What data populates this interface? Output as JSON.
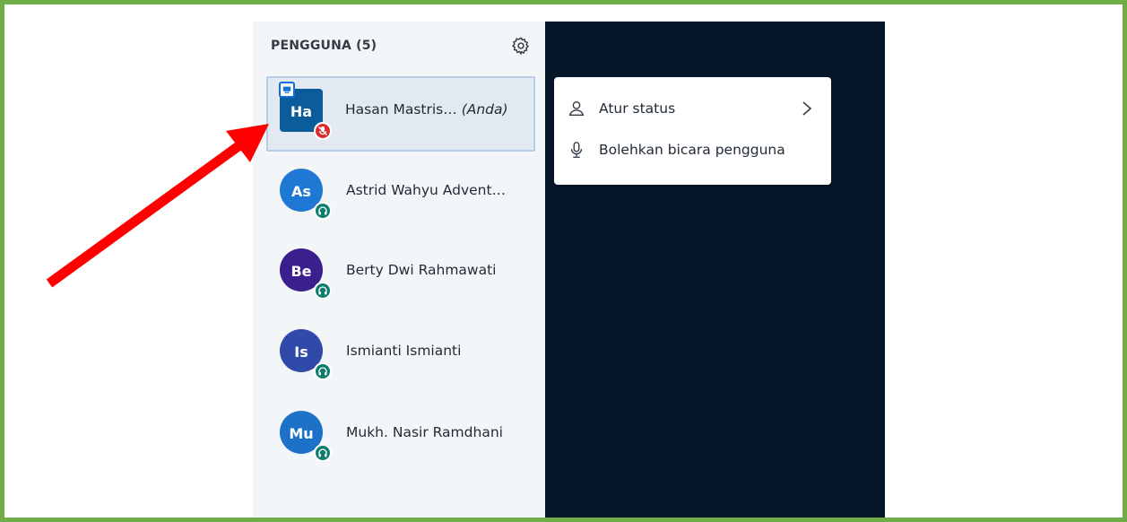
{
  "panel": {
    "header": "PENGGUNA (5)",
    "settings_icon": "gear-icon"
  },
  "users": [
    {
      "initials": "Ha",
      "name": "Hasan Mastris…",
      "suffix": "(Anda)",
      "color": "#0b5c9a",
      "status": "muted",
      "presenter": true,
      "selected": true
    },
    {
      "initials": "As",
      "name": "Astrid Wahyu Advent…",
      "color": "#1e78d4",
      "status": "listen-only"
    },
    {
      "initials": "Be",
      "name": "Berty Dwi Rahmawati",
      "color": "#3b1f8e",
      "status": "listen-only"
    },
    {
      "initials": "Is",
      "name": "Ismianti Ismianti",
      "color": "#2f4aa8",
      "status": "listen-only"
    },
    {
      "initials": "Mu",
      "name": "Mukh. Nasir Ramdhani",
      "color": "#1d72c8",
      "status": "listen-only"
    }
  ],
  "context_menu": {
    "items": [
      {
        "label": "Atur status",
        "icon": "user-icon",
        "submenu": true
      },
      {
        "label": "Bolehkan bicara pengguna",
        "icon": "microphone-icon"
      }
    ]
  },
  "colors": {
    "frame": "#70ad47",
    "sidebar": "#f3f6f9",
    "dark_area": "#06172a",
    "arrow": "#ff0000",
    "muted_badge": "#d92f2f",
    "listen_badge": "#0f7d6b"
  }
}
